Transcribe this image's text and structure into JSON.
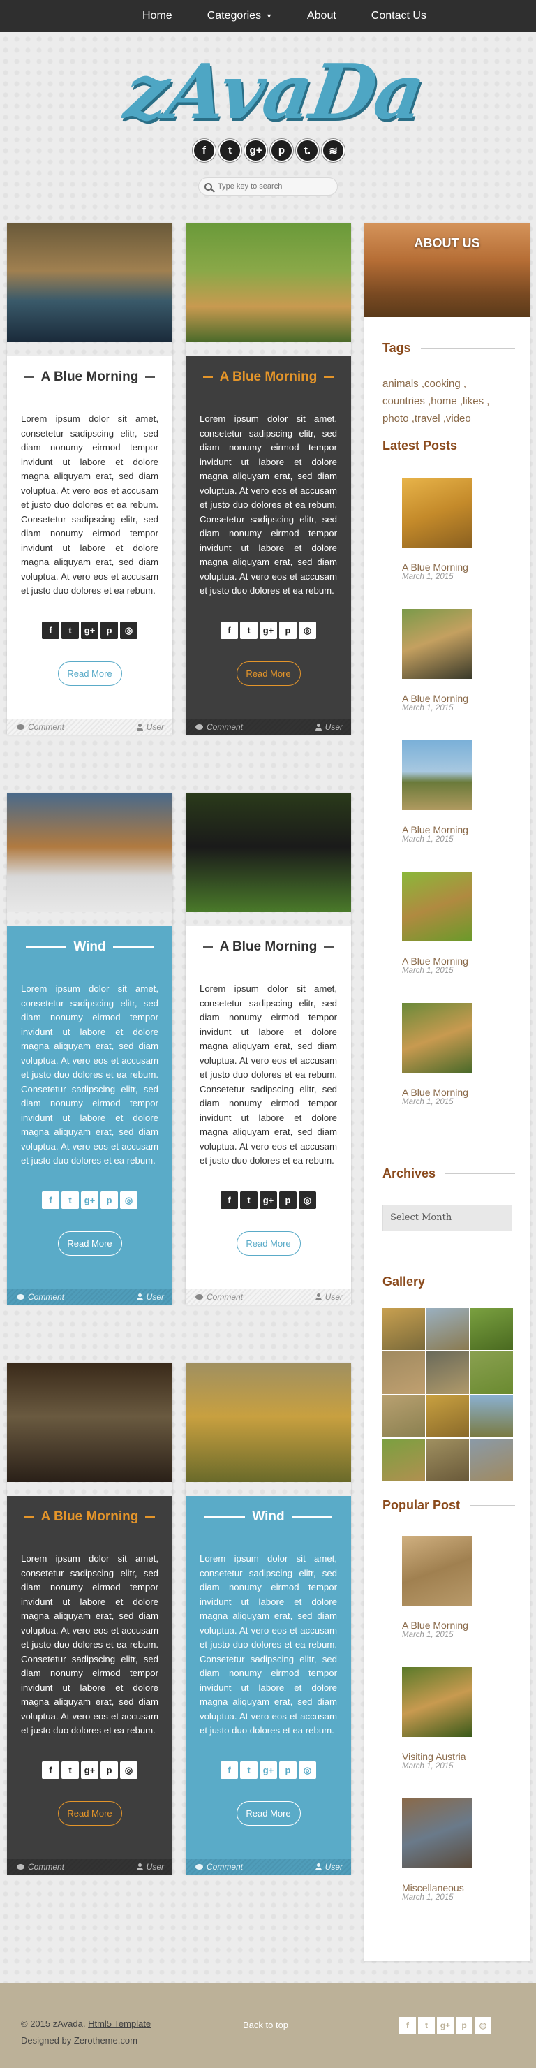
{
  "nav": {
    "items": [
      {
        "label": "Home"
      },
      {
        "label": "Categories",
        "has_dropdown": true
      },
      {
        "label": "About"
      },
      {
        "label": "Contact Us"
      }
    ]
  },
  "header": {
    "logo": "zAvaDa",
    "social": [
      {
        "icon": "facebook-icon",
        "glyph": "f"
      },
      {
        "icon": "twitter-icon",
        "glyph": "t"
      },
      {
        "icon": "google-plus-icon",
        "glyph": "g+"
      },
      {
        "icon": "pinterest-icon",
        "glyph": "p"
      },
      {
        "icon": "tumblr-icon",
        "glyph": "t."
      },
      {
        "icon": "rss-icon",
        "glyph": "≋"
      }
    ],
    "search_placeholder": "Type key to search"
  },
  "posts": [
    {
      "title": "A Blue Morning",
      "style": "white"
    },
    {
      "title": "A Blue Morning",
      "style": "dark"
    },
    {
      "title": "Wind",
      "style": "blue"
    },
    {
      "title": "A Blue Morning",
      "style": "white"
    },
    {
      "title": "A Blue Morning",
      "style": "dark"
    },
    {
      "title": "Wind",
      "style": "blue"
    }
  ],
  "post_common": {
    "body": "Lorem ipsum dolor sit amet, consetetur sadipscing elitr, sed diam nonumy eirmod tempor invidunt ut labore et dolore magna aliquyam erat, sed diam voluptua. At vero eos et accusam et justo duo dolores et ea rebum. Consetetur sadipscing elitr, sed diam nonumy eirmod tempor invidunt ut labore et dolore magna aliquyam erat, sed diam voluptua. At vero eos et accusam et justo duo dolores et ea rebum.",
    "share_glyphs": [
      "f",
      "t",
      "g+",
      "p",
      "◎"
    ],
    "read_more": "Read More",
    "comment_label": "Comment",
    "user_label": "User"
  },
  "sidebar": {
    "about_label": "ABOUT US",
    "tags_heading": "Tags",
    "tags": "animals ,cooking , countries ,home ,likes , photo ,travel ,video",
    "latest_heading": "Latest Posts",
    "latest": [
      {
        "title": "A Blue Morning",
        "date": "March 1, 2015"
      },
      {
        "title": "A Blue Morning",
        "date": "March 1, 2015"
      },
      {
        "title": "A Blue Morning",
        "date": "March 1, 2015"
      },
      {
        "title": "A Blue Morning",
        "date": "March 1, 2015"
      },
      {
        "title": "A Blue Morning",
        "date": "March 1, 2015"
      }
    ],
    "archives_heading": "Archives",
    "archives_select": "Select Month",
    "gallery_heading": "Gallery",
    "popular_heading": "Popular Post",
    "popular": [
      {
        "title": "A Blue Morning",
        "date": "March 1, 2015"
      },
      {
        "title": "Visiting Austria",
        "date": "March 1, 2015"
      },
      {
        "title": "Miscellaneous",
        "date": "March 1, 2015"
      }
    ]
  },
  "footer": {
    "copyright": "© 2015 zAvada.",
    "template_link": "Html5 Template",
    "designed_by": "Designed by Zerotheme.com",
    "back_to_top": "Back to top",
    "share_glyphs": [
      "f",
      "t",
      "g+",
      "p",
      "◎"
    ]
  },
  "colors": {
    "accent_blue": "#5aabc8",
    "accent_orange": "#e4952a",
    "dark_card": "#3e3e3e",
    "sidebar_heading": "#8a4a1c",
    "footer_bg": "#bcb198"
  }
}
